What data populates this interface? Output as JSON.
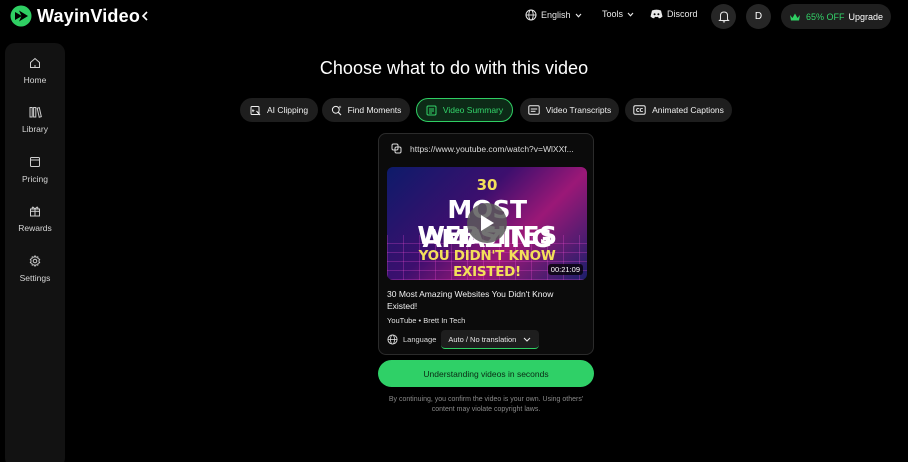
{
  "brand": {
    "name": "WayinVideo",
    "accent": "#2fcf63"
  },
  "header": {
    "language": "English",
    "tools": "Tools",
    "discord": "Discord",
    "avatar_initial": "D",
    "upgrade_discount": "65% OFF",
    "upgrade_label": "Upgrade"
  },
  "sidebar": {
    "items": [
      {
        "label": "Home",
        "icon": "home-icon"
      },
      {
        "label": "Library",
        "icon": "library-icon"
      },
      {
        "label": "Pricing",
        "icon": "pricing-icon"
      },
      {
        "label": "Rewards",
        "icon": "gift-icon"
      },
      {
        "label": "Settings",
        "icon": "gear-icon"
      }
    ]
  },
  "main": {
    "title": "Choose what to do with this video",
    "tabs": [
      {
        "label": "AI Clipping",
        "icon": "ai-clip-icon",
        "active": false
      },
      {
        "label": "Find Moments",
        "icon": "find-moments-icon",
        "active": false
      },
      {
        "label": "Video Summary",
        "icon": "summary-icon",
        "active": true
      },
      {
        "label": "Video Transcripts",
        "icon": "transcript-icon",
        "active": false
      },
      {
        "label": "Animated Captions",
        "icon": "captions-icon",
        "active": false
      }
    ]
  },
  "video": {
    "url": "https://www.youtube.com/watch?v=WlXXf...",
    "thumbnail_text": {
      "number": "30",
      "line1": "MOST AMAZING",
      "line2": "WEBSITES",
      "line3": "YOU DIDN'T KNOW EXISTED!"
    },
    "duration": "00:21:09",
    "title": "30 Most Amazing Websites You Didn't Know Existed!",
    "meta": "YouTube • Brett In Tech",
    "language_label": "Language",
    "language_value": "Auto / No translation"
  },
  "cta": {
    "label": "Understanding videos in seconds"
  },
  "disclaimer": "By continuing, you confirm the video is your own. Using others' content may violate copyright laws."
}
